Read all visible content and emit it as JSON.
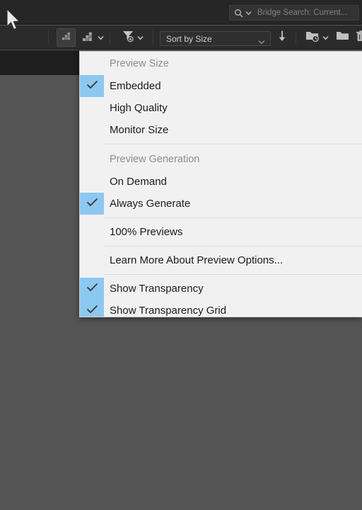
{
  "titlebar": {
    "search": {
      "placeholder": "Bridge Search: Current...",
      "icon": "search-icon",
      "chevron_icon": "chevron-down-icon"
    }
  },
  "toolbar": {
    "buttons": [
      {
        "name": "thumbnail-size-small-button",
        "icon": "staircase-small-icon",
        "active": true
      },
      {
        "name": "thumbnail-size-large-button",
        "icon": "staircase-large-icon",
        "active": false
      },
      {
        "name": "filter-button",
        "icon": "funnel-star-icon",
        "active": false
      },
      {
        "name": "sort-direction-button",
        "icon": "arrow-down-icon",
        "active": false
      },
      {
        "name": "recent-folders-button",
        "icon": "folder-clock-icon",
        "active": false
      },
      {
        "name": "new-folder-button",
        "icon": "folder-icon",
        "active": false
      },
      {
        "name": "delete-button",
        "icon": "trash-icon",
        "active": false
      }
    ],
    "sort": {
      "label": "Sort by Size",
      "chevron_icon": "chevron-down-icon"
    }
  },
  "menu": {
    "name": "preview-options-menu",
    "sections": [
      {
        "header": "Preview Size",
        "items": [
          {
            "label": "Embedded",
            "checked": true
          },
          {
            "label": "High Quality",
            "checked": false
          },
          {
            "label": "Monitor Size",
            "checked": false
          }
        ]
      },
      {
        "header": "Preview Generation",
        "items": [
          {
            "label": "On Demand",
            "checked": false
          },
          {
            "label": "Always Generate",
            "checked": true
          }
        ]
      },
      {
        "header": null,
        "items": [
          {
            "label": "100% Previews",
            "checked": false
          }
        ]
      },
      {
        "header": null,
        "items": [
          {
            "label": "Learn More About Preview Options...",
            "checked": false
          }
        ]
      },
      {
        "header": null,
        "items": [
          {
            "label": "Show Transparency",
            "checked": true
          },
          {
            "label": "Show Transparency Grid",
            "checked": true
          }
        ]
      }
    ]
  },
  "colors": {
    "menu_bg": "#f1f1f1",
    "check_highlight": "#8dc8f0",
    "app_bg": "#545454",
    "toolbar_bg": "#2b2b2b",
    "titlebar_bg": "#262626"
  },
  "cursor": {
    "icon": "arrow-cursor"
  }
}
